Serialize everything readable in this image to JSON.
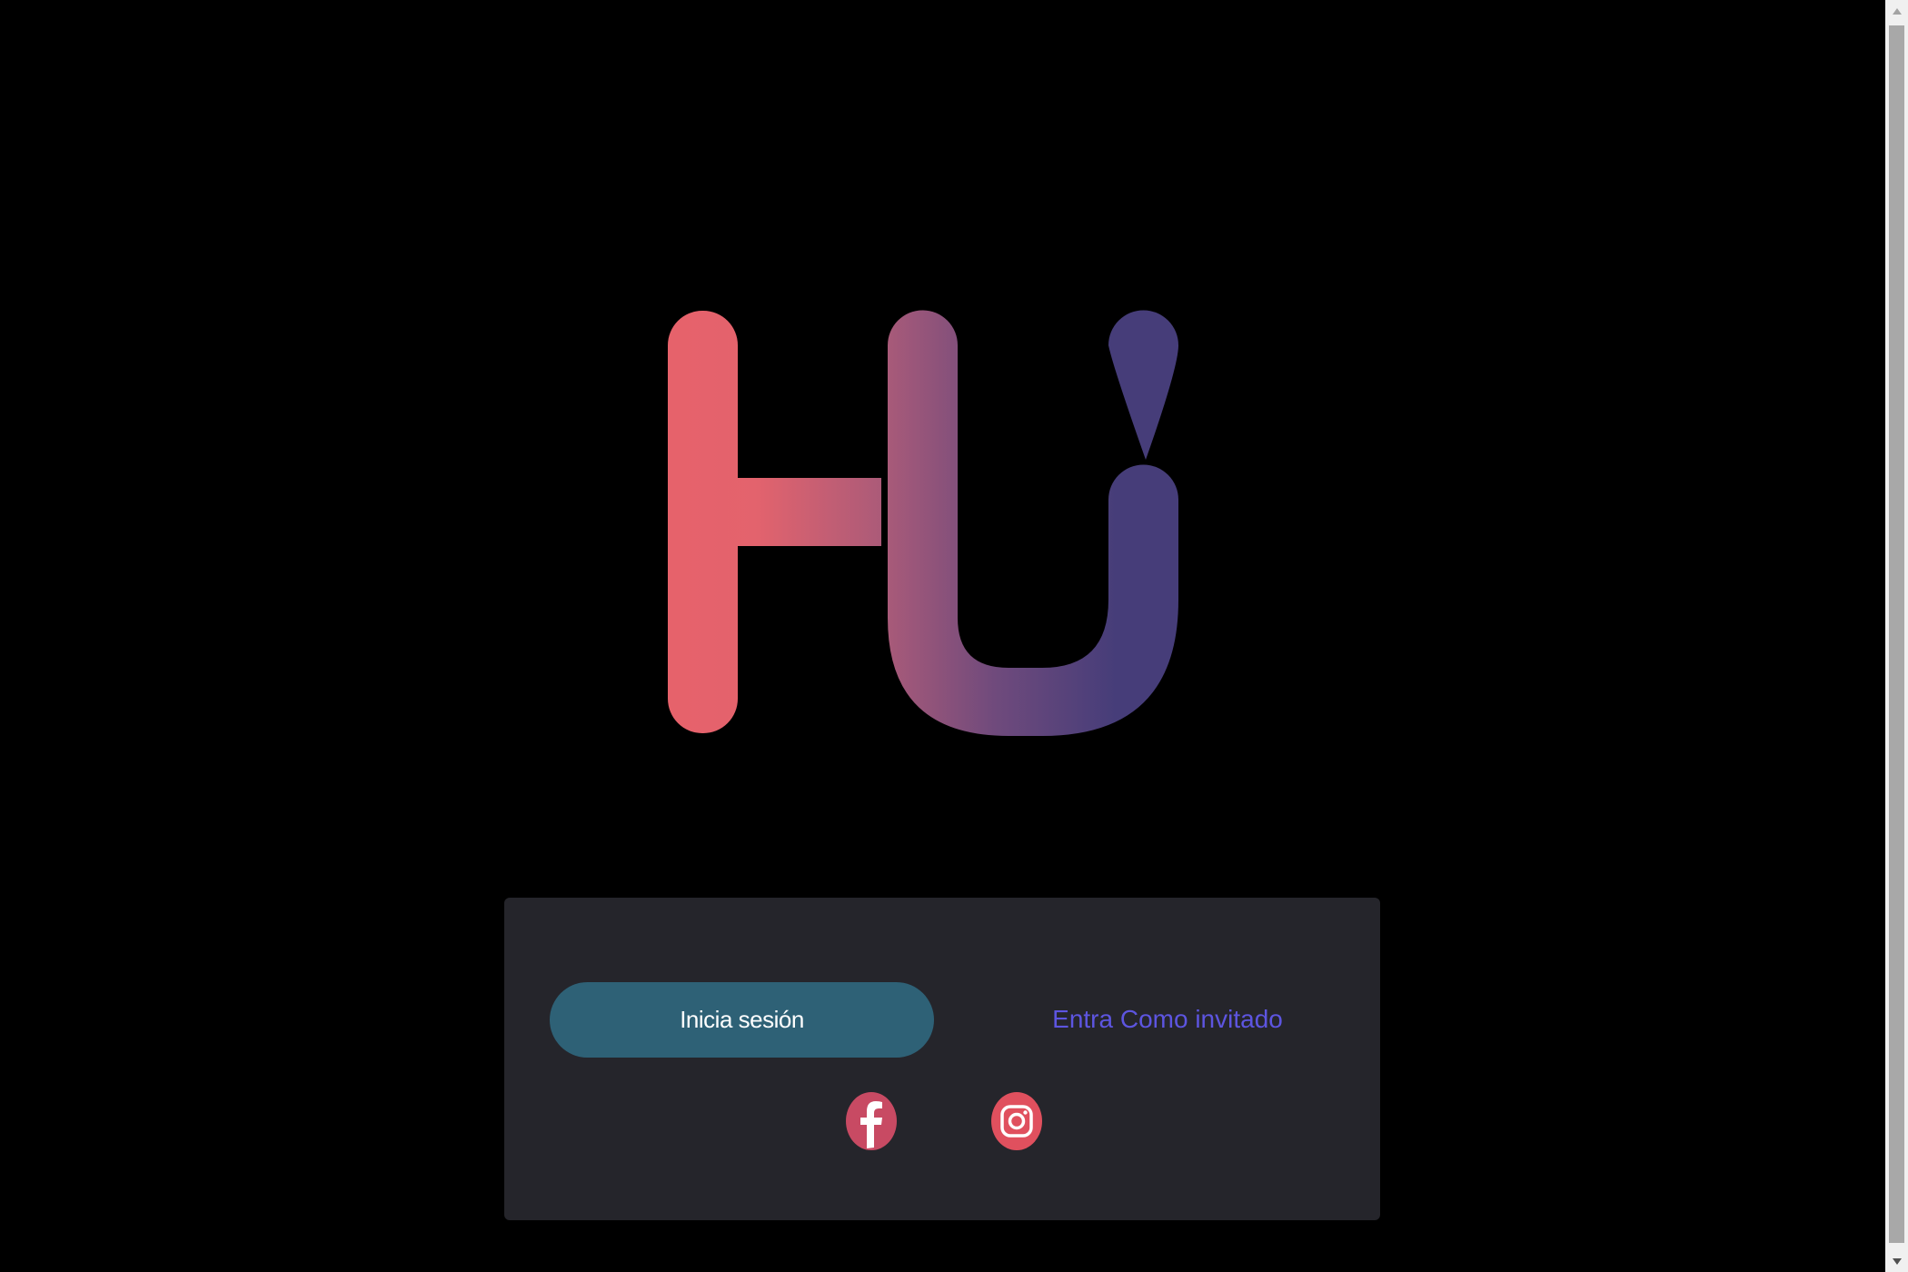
{
  "logo": {
    "icon": "hu-logo",
    "gradient_start": "#e8616a",
    "gradient_end": "#463d79"
  },
  "panel": {
    "login_button": "Inicia sesión",
    "guest_link": "Entra Como invitado"
  },
  "social": [
    {
      "icon": "facebook-icon",
      "color": "#c84a63"
    },
    {
      "icon": "instagram-icon",
      "color": "#e0505e"
    }
  ],
  "colors": {
    "background": "#000000",
    "panel": "#25252b",
    "login_button": "#2e6176",
    "guest_link": "#5d55e0"
  }
}
